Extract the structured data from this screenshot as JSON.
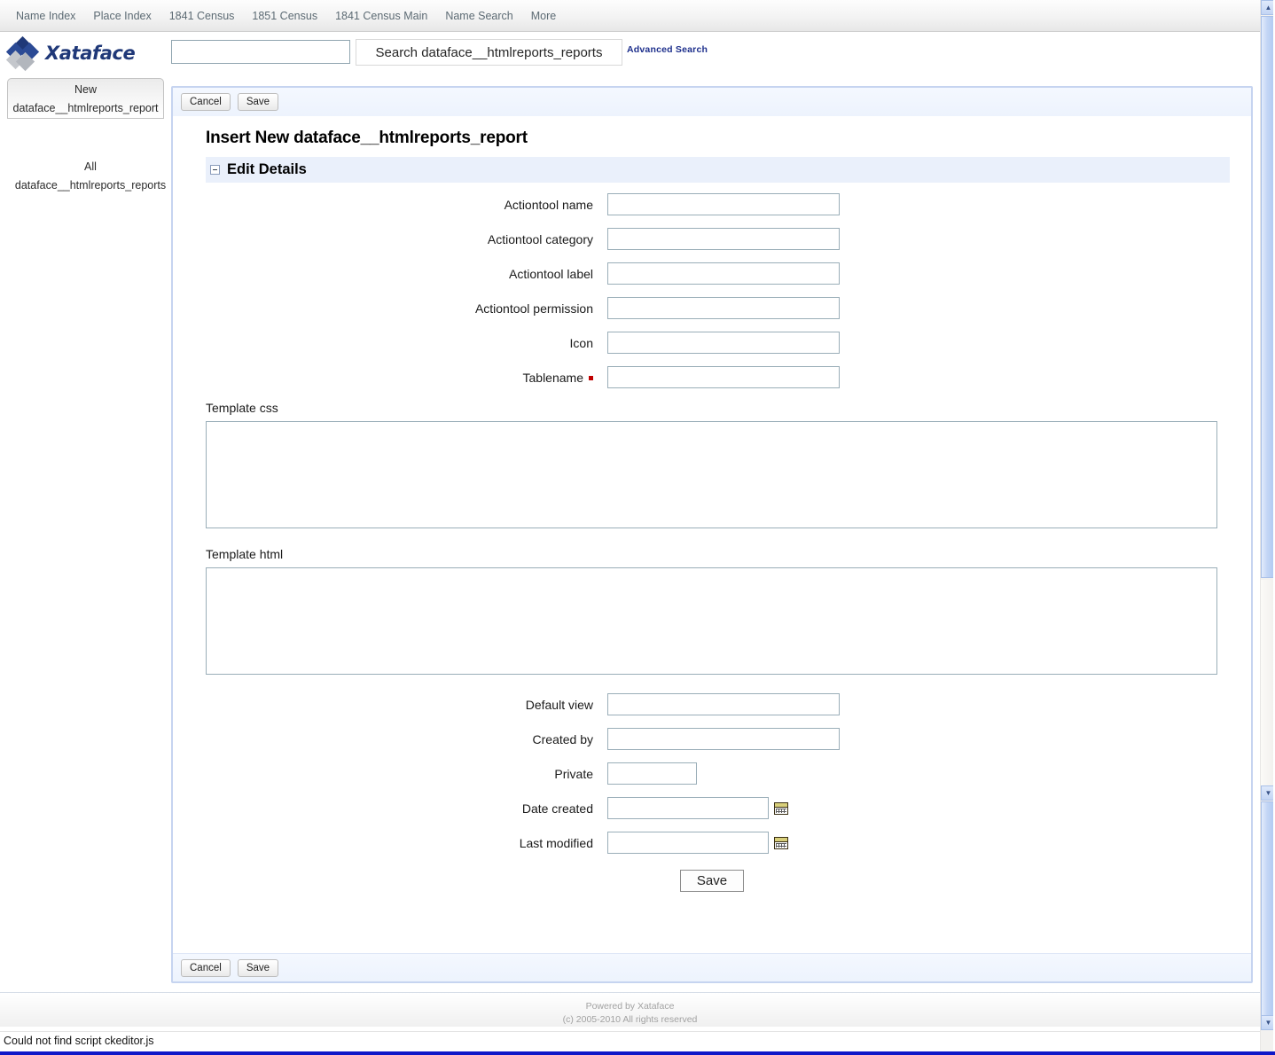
{
  "topnav": {
    "items": [
      {
        "label": "Name Index"
      },
      {
        "label": "Place Index"
      },
      {
        "label": "1841 Census"
      },
      {
        "label": "1851 Census"
      },
      {
        "label": "1841 Census Main"
      },
      {
        "label": "Name Search"
      },
      {
        "label": "More"
      }
    ]
  },
  "header": {
    "logo_text": "Xataface",
    "search_value": "",
    "search_placeholder": "",
    "search_button_label": "Search dataface__htmlreports_reports",
    "advanced_search_label": "Advanced Search"
  },
  "sidebar": {
    "tab_new_line1": "New",
    "tab_new_line2": "dataface__htmlreports_report",
    "all_link_line1": "All",
    "all_link_line2": "dataface__htmlreports_reports"
  },
  "toolbar": {
    "cancel_label": "Cancel",
    "save_label": "Save"
  },
  "main": {
    "page_title": "Insert New dataface__htmlreports_report",
    "section_title": "Edit Details",
    "fields": [
      {
        "label": "Actiontool name",
        "value": "",
        "required": false,
        "width": "normal"
      },
      {
        "label": "Actiontool category",
        "value": "",
        "required": false,
        "width": "normal"
      },
      {
        "label": "Actiontool label",
        "value": "",
        "required": false,
        "width": "normal"
      },
      {
        "label": "Actiontool permission",
        "value": "",
        "required": false,
        "width": "normal"
      },
      {
        "label": "Icon",
        "value": "",
        "required": false,
        "width": "normal"
      },
      {
        "label": "Tablename",
        "value": "",
        "required": true,
        "width": "normal"
      }
    ],
    "textareas": [
      {
        "label": "Template css",
        "value": ""
      },
      {
        "label": "Template html",
        "value": ""
      }
    ],
    "fields2": [
      {
        "label": "Default view",
        "value": "",
        "required": false,
        "width": "normal",
        "calendar": false
      },
      {
        "label": "Created by",
        "value": "",
        "required": false,
        "width": "normal",
        "calendar": false
      },
      {
        "label": "Private",
        "value": "",
        "required": false,
        "width": "short",
        "calendar": false
      },
      {
        "label": "Date created",
        "value": "",
        "required": false,
        "width": "date",
        "calendar": true
      },
      {
        "label": "Last modified",
        "value": "",
        "required": false,
        "width": "date",
        "calendar": true
      }
    ],
    "save_center_label": "Save"
  },
  "footer": {
    "line1": "Powered by Xataface",
    "line2": "(c) 2005-2010 All rights reserved"
  },
  "statusbar": {
    "message": "Could not find script ckeditor.js"
  },
  "colors": {
    "accent_blue": "#1d2f8c",
    "panel_border": "#c6d4f0",
    "section_bg": "#eaf0fb",
    "required_red": "#c00000",
    "bottom_bar": "#1018c8"
  }
}
